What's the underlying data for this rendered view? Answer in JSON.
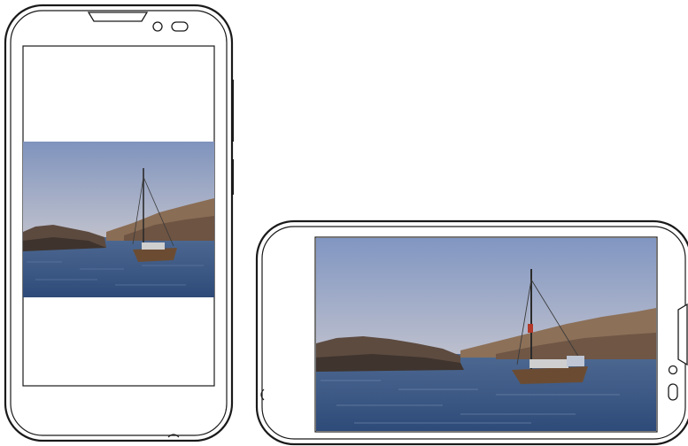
{
  "figure": {
    "portrait_device": {
      "orientation": "portrait",
      "photo": "sailboat-at-sea"
    },
    "landscape_device": {
      "orientation": "landscape",
      "photo": "sailboat-at-sea"
    },
    "colors": {
      "outline": "#1a1a1a",
      "sky_top": "#8ea0c4",
      "sky_horizon": "#e8c9a8",
      "sea": "#3d5a86",
      "land": "#8a6d52"
    }
  }
}
